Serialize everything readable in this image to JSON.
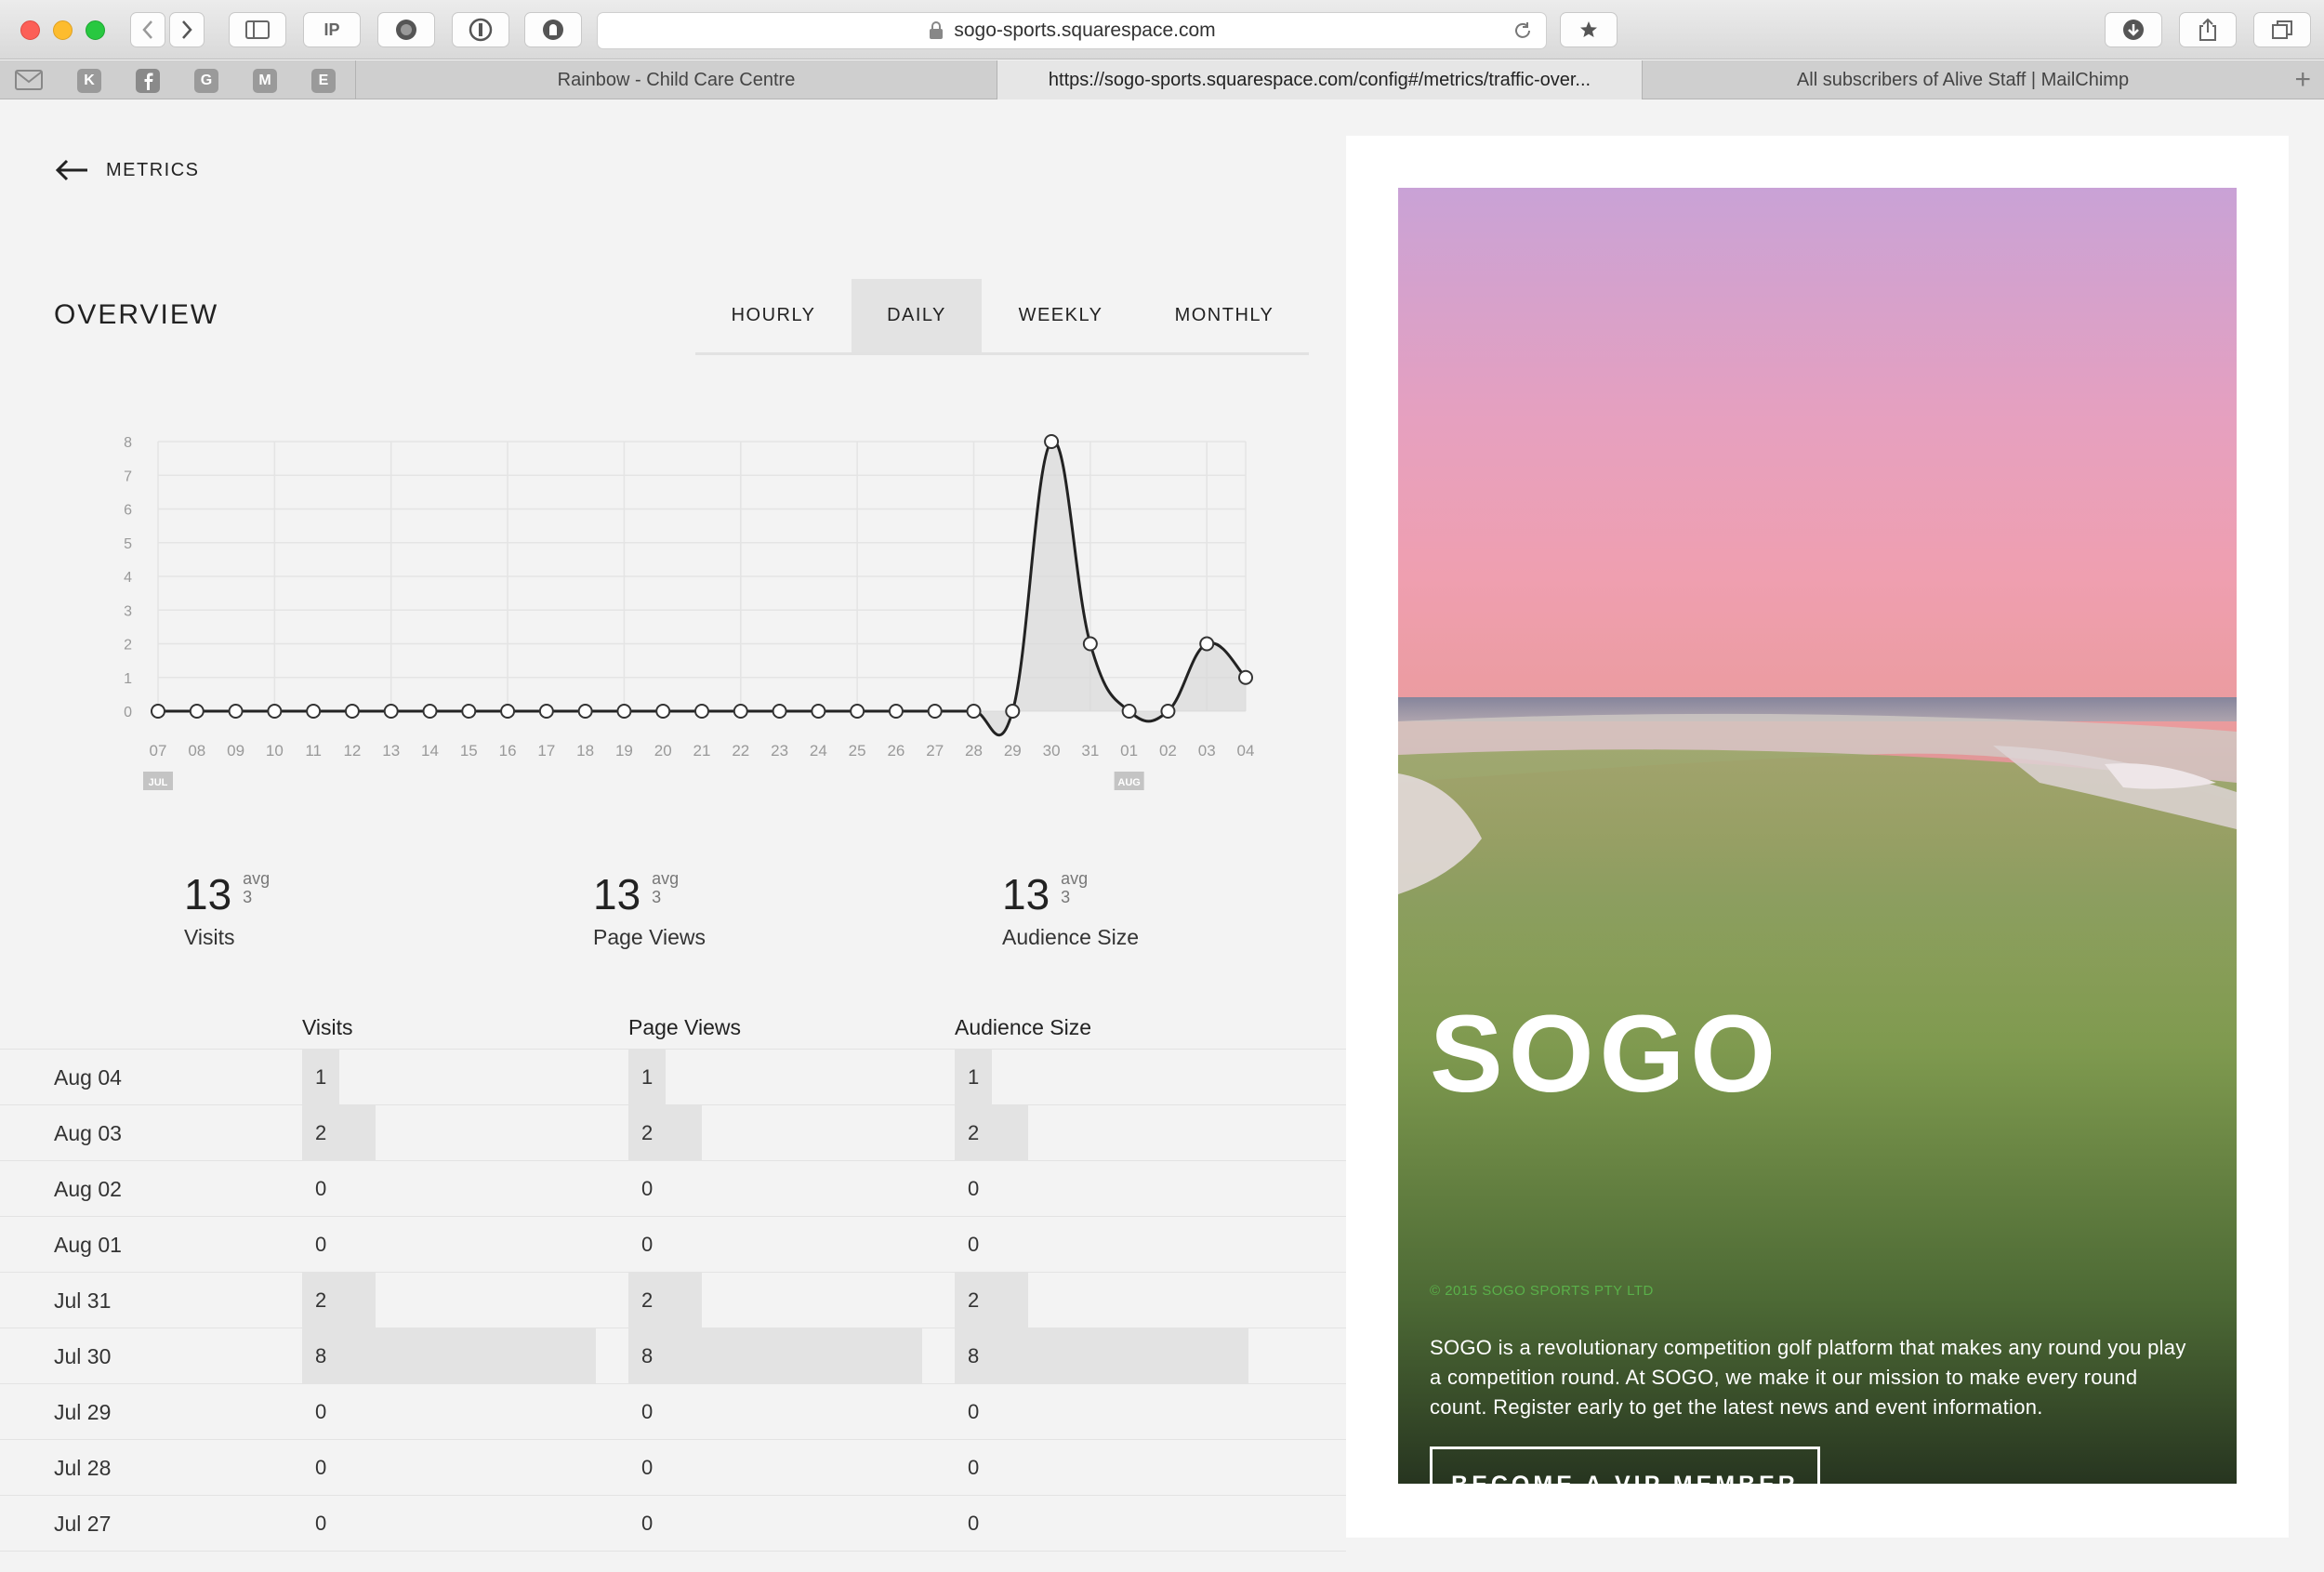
{
  "browser": {
    "url": "sogo-sports.squarespace.com",
    "toolbar_ip_label": "IP",
    "bookmarks": [
      "K",
      "G",
      "M",
      "E"
    ],
    "tabs": [
      {
        "label": "Rainbow - Child Care Centre",
        "active": false
      },
      {
        "label": "https://sogo-sports.squarespace.com/config#/metrics/traffic-over...",
        "active": true
      },
      {
        "label": "All subscribers of Alive Staff | MailChimp",
        "active": false
      }
    ]
  },
  "header": {
    "back_label": "METRICS",
    "title": "OVERVIEW",
    "period_tabs": [
      {
        "label": "HOURLY",
        "active": false
      },
      {
        "label": "DAILY",
        "active": true
      },
      {
        "label": "WEEKLY",
        "active": false
      },
      {
        "label": "MONTHLY",
        "active": false
      }
    ]
  },
  "chart_data": {
    "type": "area",
    "x": [
      "07",
      "08",
      "09",
      "10",
      "11",
      "12",
      "13",
      "14",
      "15",
      "16",
      "17",
      "18",
      "19",
      "20",
      "21",
      "22",
      "23",
      "24",
      "25",
      "26",
      "27",
      "28",
      "29",
      "30",
      "31",
      "01",
      "02",
      "03",
      "04"
    ],
    "month_markers": [
      {
        "index": 0,
        "label": "JUL"
      },
      {
        "index": 25,
        "label": "AUG"
      }
    ],
    "series": [
      {
        "values": [
          0,
          0,
          0,
          0,
          0,
          0,
          0,
          0,
          0,
          0,
          0,
          0,
          0,
          0,
          0,
          0,
          0,
          0,
          0,
          0,
          0,
          0,
          0,
          8,
          2,
          0,
          0,
          2,
          1
        ]
      }
    ],
    "ylim": [
      0,
      8
    ],
    "yticks": [
      "0",
      "1",
      "2",
      "3",
      "4",
      "5",
      "6",
      "7",
      "8"
    ],
    "grid": true
  },
  "stats": [
    {
      "value": "13",
      "avg_label": "avg",
      "avg_value": "3",
      "label": "Visits"
    },
    {
      "value": "13",
      "avg_label": "avg",
      "avg_value": "3",
      "label": "Page Views"
    },
    {
      "value": "13",
      "avg_label": "avg",
      "avg_value": "3",
      "label": "Audience Size"
    }
  ],
  "table": {
    "headers": [
      "Visits",
      "Page Views",
      "Audience Size"
    ],
    "max": 8,
    "rows": [
      {
        "date": "Aug 04",
        "visits": 1,
        "page_views": 1,
        "audience": 1
      },
      {
        "date": "Aug 03",
        "visits": 2,
        "page_views": 2,
        "audience": 2
      },
      {
        "date": "Aug 02",
        "visits": 0,
        "page_views": 0,
        "audience": 0
      },
      {
        "date": "Aug 01",
        "visits": 0,
        "page_views": 0,
        "audience": 0
      },
      {
        "date": "Jul 31",
        "visits": 2,
        "page_views": 2,
        "audience": 2
      },
      {
        "date": "Jul 30",
        "visits": 8,
        "page_views": 8,
        "audience": 8
      },
      {
        "date": "Jul 29",
        "visits": 0,
        "page_views": 0,
        "audience": 0
      },
      {
        "date": "Jul 28",
        "visits": 0,
        "page_views": 0,
        "audience": 0
      },
      {
        "date": "Jul 27",
        "visits": 0,
        "page_views": 0,
        "audience": 0
      }
    ]
  },
  "preview": {
    "logo_text": "SOGO",
    "copyright": "© 2015 SOGO SPORTS PTY LTD",
    "description": "SOGO is a revolutionary competition golf platform that makes any round you play a competition round. At SOGO, we make it our mission to make every round count. Register early to get the latest news and event information.",
    "cta_label": "BECOME A VIP MEMBER"
  },
  "colors": {
    "accent_bar": "#e3e3e3",
    "chart_line": "#222222",
    "copyright_green": "#5ab04a"
  }
}
